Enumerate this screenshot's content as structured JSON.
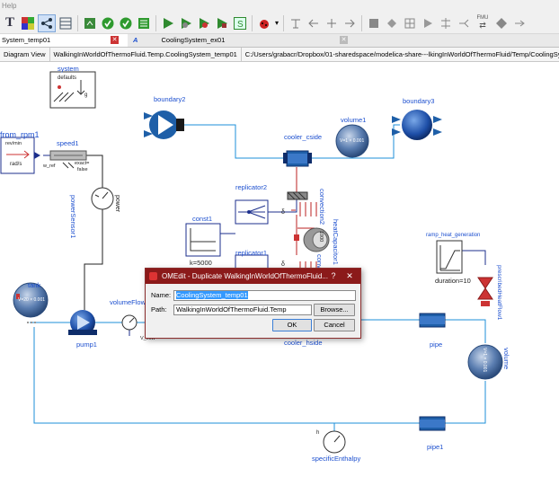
{
  "menu": {
    "help_label": "Help"
  },
  "toolbar": {
    "icons": [
      "text-tool-icon",
      "color-grid-icon",
      "connect-mode-icon",
      "transition-mode-icon",
      "diagram-view-icon",
      "check-model-icon",
      "check-all-icon",
      "instantiate-icon",
      "simulate-icon",
      "simulate-plot-icon",
      "debug-icon",
      "export-fmu-icon"
    ],
    "fmu_label": "FMU"
  },
  "tabs": [
    {
      "label": "System_temp01",
      "active": true
    },
    {
      "label": "CoolingSystem_ex01",
      "active": false
    }
  ],
  "pathbar": {
    "view": "Diagram View",
    "class_name": "WalkingInWorldOfThermoFluid.Temp.CoolingSystem_temp01",
    "file_path": "C:/Users/grabacr/Dropbox/01-sharedspace/modelica-share---lkingInWorldOfThermoFluid/Temp/CoolingSystem_temp01.mo"
  },
  "diagram": {
    "system": "system",
    "system_defaults": "defaults",
    "system_g": "g",
    "from_rpm": "from_rpm1",
    "from_rpm_top": "rev/min",
    "from_rpm_bottom": "rad/s",
    "speed": "speed1",
    "speed_wref": "w_ref",
    "speed_exact": "exact=",
    "speed_false": "false",
    "power_sensor": "powerSensor1",
    "power": "power",
    "boundary2": "boundary2",
    "boundary3": "boundary3",
    "volume1": "volume1",
    "volume1_v": "V=1 × 0.001",
    "cooler_cside": "cooler_cside",
    "replicator2": "replicator2",
    "replicator1": "replicator1",
    "convection2": "convection2",
    "convection1": "convection1",
    "heat_capacitor": "heatCapacitor1",
    "heat_capacitor_value": "1000",
    "const": "const1",
    "const_k": "k=5000",
    "ramp": "ramp_heat_generation",
    "ramp_duration": "duration=10",
    "prescribed": "prescribedHeatFlow1",
    "tank": "tank",
    "tank_v": "V=20 × 0.001",
    "pump": "pump1",
    "volume_flow": "volumeFlowR...",
    "v_flow": "V_flow",
    "cooler_hside": "cooler_hside",
    "pipe": "pipe",
    "pipe1": "pipe1",
    "volume": "volume",
    "volume_v": "V=1 × 0.001",
    "specific_enthalpy": "specificEnthalpy",
    "specific_h": "h"
  },
  "dialog": {
    "title": "OMEdit - Duplicate WalkingInWorldOfThermoFluid...",
    "help": "?",
    "close": "✕",
    "name_label": "Name:",
    "name_value": "CoolingSystem_temp01",
    "path_label": "Path:",
    "path_value": "WalkingInWorldOfThermoFluid.Temp",
    "browse_label": "Browse...",
    "ok_label": "OK",
    "cancel_label": "Cancel"
  },
  "colors": {
    "accent_blue": "#1c4fcf",
    "dialog_title": "#8b1a1a",
    "component_blue": "#1e5fa8"
  }
}
